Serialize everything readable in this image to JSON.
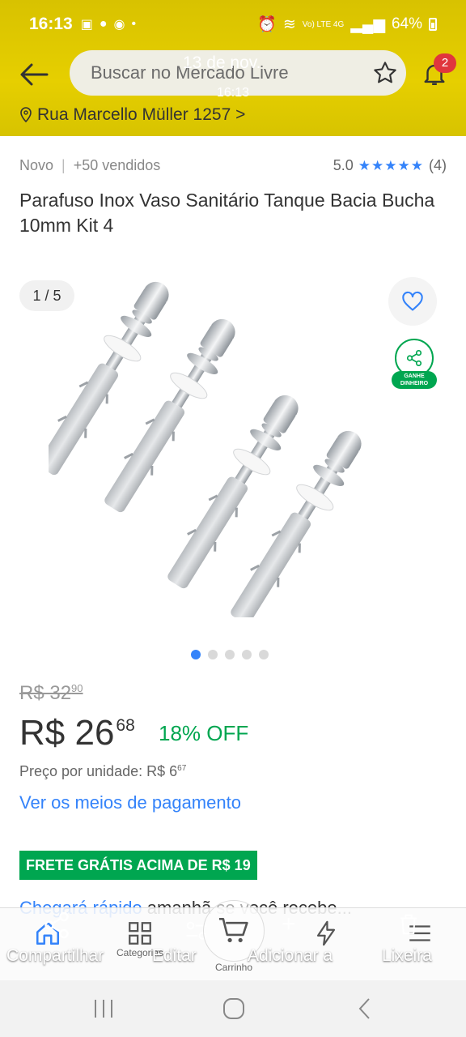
{
  "statusbar": {
    "time": "16:13",
    "battery": "64%",
    "network": "Vo) LTE 4G"
  },
  "header": {
    "search_placeholder": "Buscar no Mercado Livre",
    "overlay_date": "13 de nov.",
    "overlay_time": "16:13",
    "notifications": "2",
    "address": "Rua Marcello Müller 1257 >"
  },
  "product": {
    "condition": "Novo",
    "sold": "+50 vendidos",
    "rating": "5.0",
    "stars": "★★★★★",
    "reviews": "(4)",
    "title": "Parafuso Inox Vaso Sanitário Tanque Bacia Bucha 10mm Kit 4",
    "image_counter": "1 / 5",
    "share_badge": "GANHE DINHEIRO",
    "old_price_int": "R$ 32",
    "old_price_cents": "90",
    "price_int": "R$ 26",
    "price_cents": "68",
    "discount": "18% OFF",
    "unit_price_int": "Preço por unidade: R$ 6",
    "unit_price_cents": "67",
    "payment_link": "Ver os meios de pagamento",
    "shipping_badge": "FRETE GRÁTIS ACIMA DE R$ 19",
    "arrival_link": "Chegará rápido",
    "arrival_rest": " amanhã se você recebe..."
  },
  "bottomnav": {
    "categories": "Categorias",
    "cart": "Carrinho"
  },
  "context_menu": {
    "share": "Compartilhar",
    "edit": "Editar",
    "add": "Adicionar a",
    "trash": "Lixeira"
  },
  "colors": {
    "header": "#e6cf00",
    "accent": "#3483fa",
    "success": "#00a650",
    "badge": "#e0363d"
  }
}
